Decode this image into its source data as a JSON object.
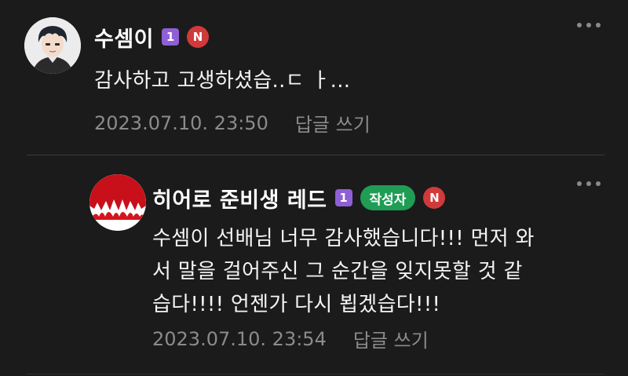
{
  "comments": [
    {
      "author": "수셈이",
      "level": "1",
      "is_new_label": "N",
      "text": "감사하고 고생하셨습..ㄷ ㅏ...",
      "timestamp": "2023.07.10. 23:50",
      "reply_label": "답글 쓰기",
      "avatar_icon": "anime-boy-avatar"
    },
    {
      "author": "히어로 준비생 레드",
      "level": "1",
      "author_badge": "작성자",
      "is_new_label": "N",
      "text_lines": [
        "수셈이 선배님 너무 감사했습니다!!! 먼저 와",
        "서 말을 걸어주신 그 순간을 잊지못할 것 같",
        "습다!!!! 언젠가 다시 뵙겠습다!!!"
      ],
      "timestamp": "2023.07.10. 23:54",
      "reply_label": "답글 쓰기",
      "avatar_icon": "red-flame-avatar"
    }
  ],
  "colors": {
    "background": "#1b1b1b",
    "level_badge": "#8f5fd6",
    "author_badge": "#1f9d55",
    "new_badge": "#d13a3a",
    "meta_text": "#8b8b8b"
  }
}
